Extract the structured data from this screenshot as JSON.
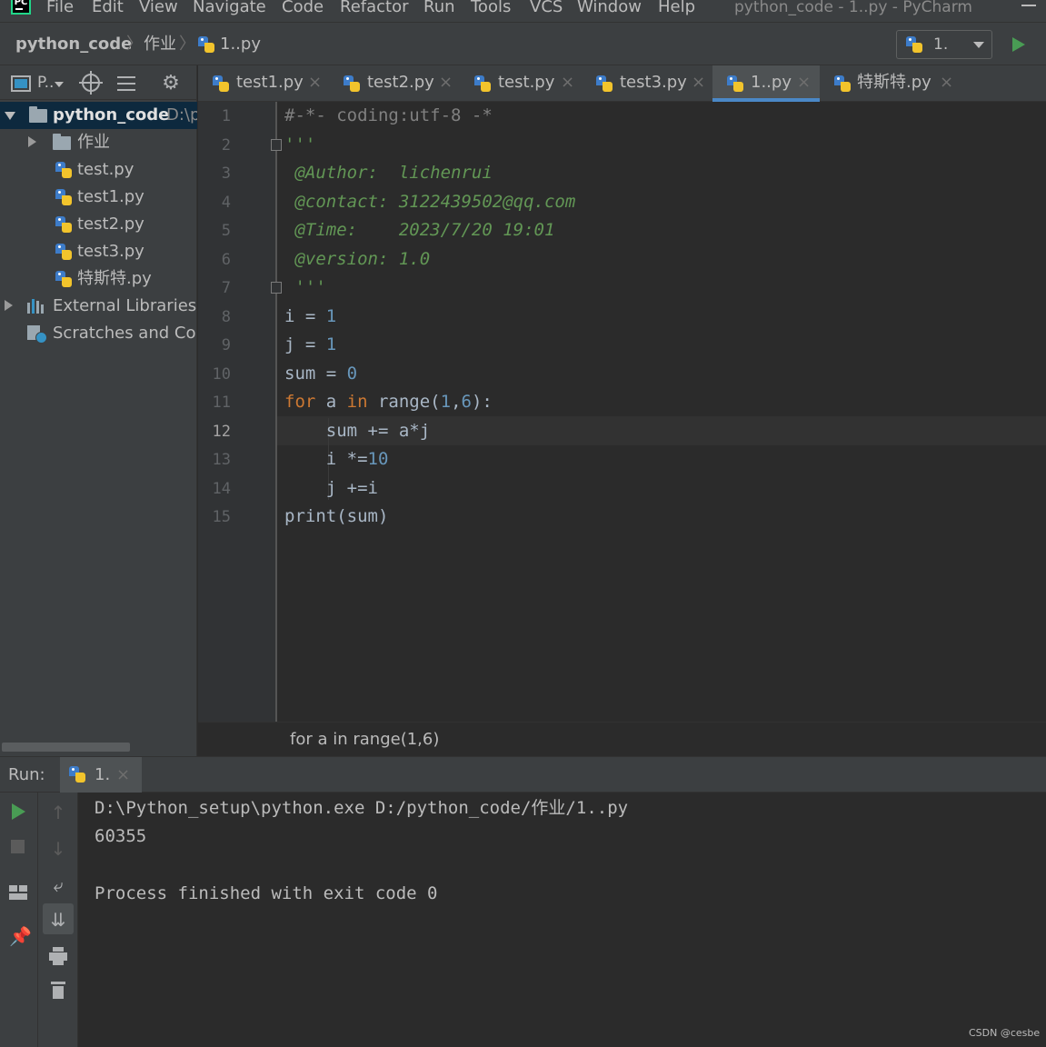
{
  "menubar": {
    "items": [
      "File",
      "Edit",
      "View",
      "Navigate",
      "Code",
      "Refactor",
      "Run",
      "Tools",
      "VCS",
      "Window",
      "Help"
    ],
    "window_title": "python_code - 1..py - PyCharm",
    "logo_text": "PC"
  },
  "navbar": {
    "breadcrumb": [
      "python_code",
      "作业",
      "1..py"
    ],
    "run_config": "1."
  },
  "project_panel": {
    "view_label": "P..",
    "tree": [
      {
        "label": "python_code",
        "path": "D:\\python_code",
        "kind": "root-folder",
        "expanded": true
      },
      {
        "label": "作业",
        "kind": "folder",
        "expanded": false
      },
      {
        "label": "test.py",
        "kind": "python-file"
      },
      {
        "label": "test1.py",
        "kind": "python-file"
      },
      {
        "label": "test2.py",
        "kind": "python-file"
      },
      {
        "label": "test3.py",
        "kind": "python-file"
      },
      {
        "label": "特斯特.py",
        "kind": "python-file"
      },
      {
        "label": "External Libraries",
        "kind": "libraries"
      },
      {
        "label": "Scratches and Consoles",
        "kind": "scratches"
      }
    ]
  },
  "editor": {
    "tabs": [
      {
        "label": "test1.py",
        "active": false
      },
      {
        "label": "test2.py",
        "active": false
      },
      {
        "label": "test.py",
        "active": false
      },
      {
        "label": "test3.py",
        "active": false
      },
      {
        "label": "1..py",
        "active": true
      },
      {
        "label": "特斯特.py",
        "active": false
      }
    ],
    "current_line": 12,
    "line_numbers": [
      "1",
      "2",
      "3",
      "4",
      "5",
      "6",
      "7",
      "8",
      "9",
      "10",
      "11",
      "12",
      "13",
      "14",
      "15"
    ],
    "code": {
      "l1": "#-*- coding:utf-8 -*",
      "l2": "'''",
      "l3": " @Author:  lichenrui",
      "l4": " @contact: 3122439502@qq.com",
      "l5": " @Time:    2023/7/20 19:01",
      "l6": " @version: 1.0",
      "l7": " '''",
      "l8": {
        "a": "i = ",
        "b": "1"
      },
      "l9": {
        "a": "j = ",
        "b": "1"
      },
      "l10": {
        "a": "sum = ",
        "b": "0"
      },
      "l11": {
        "kw1": "for",
        "a": " a ",
        "kw2": "in",
        "b": " range(",
        "n1": "1",
        "c": ",",
        "n2": "6",
        "d": "):"
      },
      "l12": "    sum += a*j",
      "l13": {
        "a": "    i *=",
        "b": "10"
      },
      "l14": "    j +=i",
      "l15": "print(sum)"
    },
    "breadcrumb": "for a in range(1,6)"
  },
  "run_panel": {
    "title": "Run:",
    "tab_label": "1.",
    "console": [
      "D:\\Python_setup\\python.exe D:/python_code/作业/1..py",
      "60355",
      "",
      "Process finished with exit code 0"
    ]
  },
  "watermark": "CSDN @cesbe",
  "colors": {
    "background": "#2b2b2b",
    "panel": "#3c3f41",
    "accent": "#4a88c7",
    "run_green": "#499c54",
    "keyword": "#cc7832",
    "number": "#6897bb",
    "docstring": "#629755"
  }
}
